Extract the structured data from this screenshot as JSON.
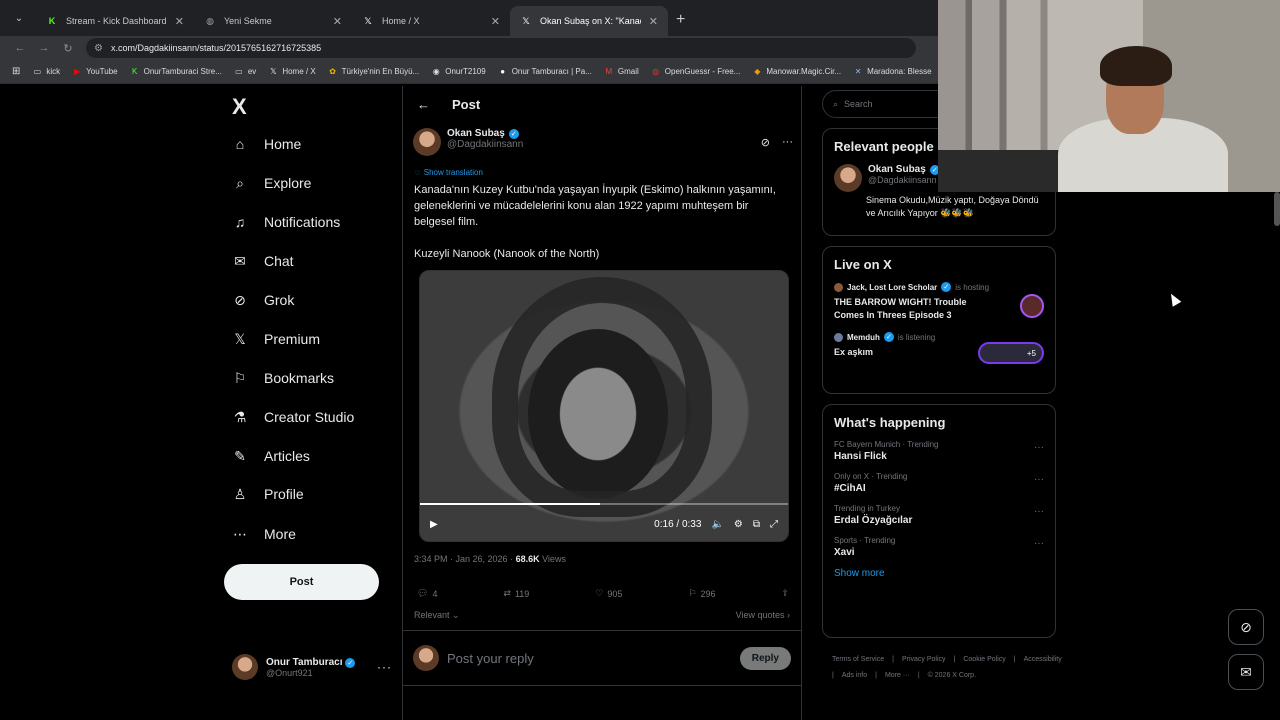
{
  "browser": {
    "tabs": [
      {
        "title": "Stream - Kick Dashboard",
        "icon": "kick-icon",
        "icon_char": "K",
        "icon_color": "#53fc18"
      },
      {
        "title": "Yeni Sekme",
        "icon": "globe-icon",
        "icon_char": "◍",
        "icon_color": "#9aa0a6"
      },
      {
        "title": "Home / X",
        "icon": "x-icon",
        "icon_char": "𝕏",
        "icon_color": "#e7e9ea"
      },
      {
        "title": "Okan Subaş on X: \"Kanada'nın K",
        "icon": "x-icon",
        "icon_char": "𝕏",
        "icon_color": "#e7e9ea"
      }
    ],
    "url": "x.com/Dagdakiinsann/status/2015765162716725385",
    "bookmarks": [
      {
        "label": "kick",
        "icon": "folder-icon",
        "char": "▭",
        "color": "#dadce0"
      },
      {
        "label": "YouTube",
        "icon": "youtube-icon",
        "char": "▶",
        "color": "#ff0000"
      },
      {
        "label": "OnurTamburaci Stre...",
        "icon": "kick-icon",
        "char": "K",
        "color": "#53fc18"
      },
      {
        "label": "ev",
        "icon": "folder-icon",
        "char": "▭",
        "color": "#dadce0"
      },
      {
        "label": "Home / X",
        "icon": "x-icon",
        "char": "𝕏",
        "color": "#e7e9ea"
      },
      {
        "label": "Türkiye'nin En Büyü...",
        "icon": "site-icon",
        "char": "✿",
        "color": "#f4b400"
      },
      {
        "label": "OnurT2109",
        "icon": "steam-icon",
        "char": "◉",
        "color": "#dadce0"
      },
      {
        "label": "Onur Tamburacı | Pa...",
        "icon": "patreon-icon",
        "char": "●",
        "color": "#ffffff"
      },
      {
        "label": "Gmail",
        "icon": "gmail-icon",
        "char": "M",
        "color": "#ea4335"
      },
      {
        "label": "OpenGuessr - Free...",
        "icon": "openguessr-icon",
        "char": "◎",
        "color": "#ea4335"
      },
      {
        "label": "Manowar.Magic.Cir...",
        "icon": "site-icon",
        "char": "◆",
        "color": "#f29900"
      },
      {
        "label": "Maradona: Blesse",
        "icon": "site-icon",
        "char": "✕",
        "color": "#8ab4f8"
      }
    ]
  },
  "nav": {
    "logo": "X",
    "items": [
      {
        "label": "Home",
        "icon": "home-icon",
        "char": "⌂"
      },
      {
        "label": "Explore",
        "icon": "search-icon",
        "char": "⌕"
      },
      {
        "label": "Notifications",
        "icon": "bell-icon",
        "char": "♫"
      },
      {
        "label": "Chat",
        "icon": "mail-icon",
        "char": "✉"
      },
      {
        "label": "Grok",
        "icon": "grok-icon",
        "char": "⊘"
      },
      {
        "label": "Premium",
        "icon": "x-icon",
        "char": "𝕏"
      },
      {
        "label": "Bookmarks",
        "icon": "bookmark-icon",
        "char": "⚐"
      },
      {
        "label": "Creator Studio",
        "icon": "flask-icon",
        "char": "⚗"
      },
      {
        "label": "Articles",
        "icon": "article-icon",
        "char": "✎"
      },
      {
        "label": "Profile",
        "icon": "person-icon",
        "char": "♙"
      },
      {
        "label": "More",
        "icon": "more-icon",
        "char": "⋯"
      }
    ],
    "post_button": "Post",
    "account": {
      "name": "Onur Tamburacı",
      "handle": "@Onurt921"
    }
  },
  "post": {
    "header": "Post",
    "author_name": "Okan Subaş",
    "author_handle": "@Dagdakiinsann",
    "show_translation": "Show translation",
    "text_p1": "Kanada'nın Kuzey Kutbu'nda yaşayan İnyupik (Eskimo) halkının yaşamını, geleneklerini ve mücadelelerini konu alan 1922 yapımı muhteşem bir belgesel film.",
    "text_p2": "Kuzeyli Nanook (Nanook of the North)",
    "video": {
      "time": "0:16 / 0:33",
      "progress": 0.49
    },
    "timestamp": "3:34 PM · Jan 26, 2026 · ",
    "views_count": "68.6K",
    "views_label": " Views",
    "actions": {
      "replies": "4",
      "reposts": "119",
      "likes": "905",
      "bookmarks": "296"
    },
    "sort_label": "Relevant",
    "view_quotes": "View quotes",
    "reply_placeholder": "Post your reply",
    "reply_button": "Reply"
  },
  "right": {
    "search_placeholder": "Search",
    "relevant": {
      "title": "Relevant people",
      "name": "Okan Subaş",
      "handle": "@Dagdakiinsann",
      "bio": "Sinema Okudu,Müzik yaptı, Doğaya Döndü ve Arıcılık Yapıyor 🐝🐝🐝"
    },
    "live": {
      "title": "Live on X",
      "items": [
        {
          "host": "Jack, Lost Lore Scholar",
          "status": "is hosting",
          "title": "THE BARROW WIGHT! Trouble Comes In Threes Episode 3"
        },
        {
          "host": "Memduh",
          "status": "is listening",
          "title": "Ex aşkım",
          "extra": "+5"
        }
      ]
    },
    "happening": {
      "title": "What's happening",
      "trends": [
        {
          "context": "FC Bayern Munich · Trending",
          "name": "Hansi Flick"
        },
        {
          "context": "Only on X · Trending",
          "name": "#CihAI"
        },
        {
          "context": "Trending in Turkey",
          "name": "Erdal Özyağcılar"
        },
        {
          "context": "Sports · Trending",
          "name": "Xavi"
        }
      ],
      "show_more": "Show more"
    },
    "footer": [
      "Terms of Service",
      "|",
      "Privacy Policy",
      "|",
      "Cookie Policy",
      "|",
      "Accessibility",
      "|",
      "Ads info",
      "|",
      "More ···",
      "|",
      "© 2026 X Corp."
    ]
  }
}
